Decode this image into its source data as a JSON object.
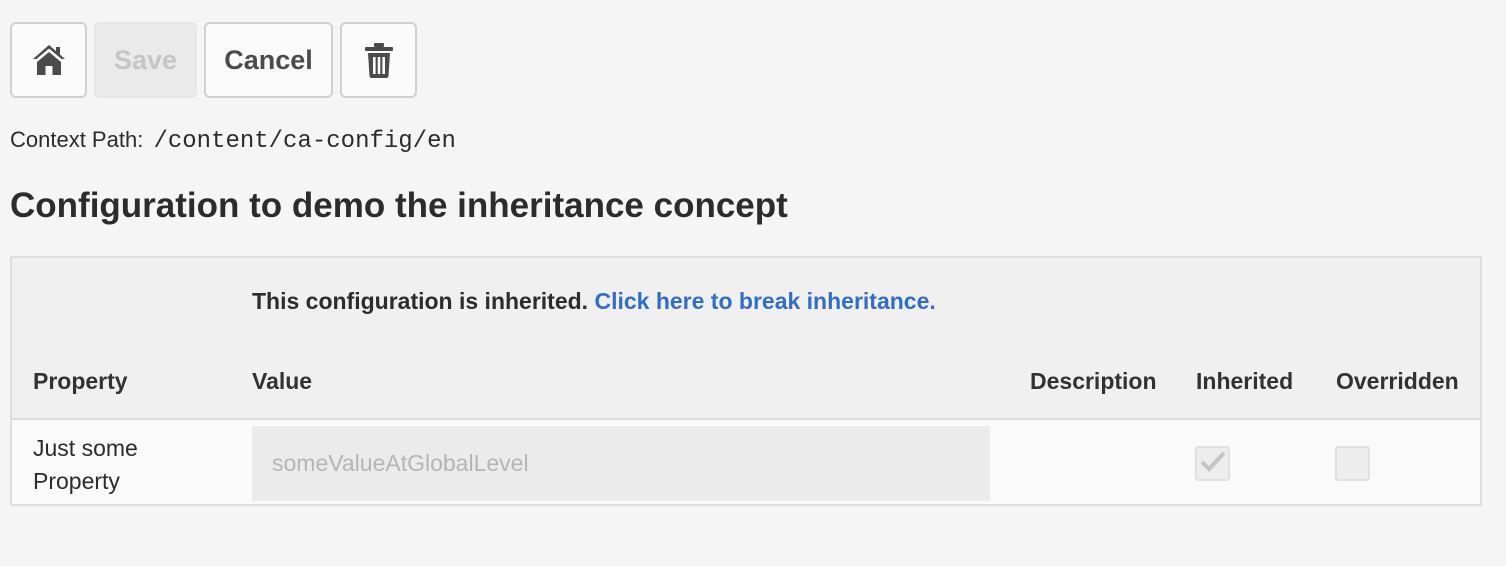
{
  "toolbar": {
    "home_icon": "home-icon",
    "save_label": "Save",
    "cancel_label": "Cancel",
    "delete_icon": "trash-icon"
  },
  "context": {
    "label": "Context Path:",
    "path": "/content/ca-config/en"
  },
  "config": {
    "title": "Configuration to demo the inheritance concept",
    "notice_text": "This configuration is inherited.",
    "break_link": "Click here to break inheritance."
  },
  "table": {
    "headers": {
      "property": "Property",
      "value": "Value",
      "description": "Description",
      "inherited": "Inherited",
      "overridden": "Overridden"
    },
    "rows": [
      {
        "property": "Just some Property",
        "value": "someValueAtGlobalLevel",
        "description": "",
        "inherited": true,
        "overridden": false
      }
    ]
  },
  "colors": {
    "link": "#326ec8",
    "background": "#f5f5f5"
  }
}
